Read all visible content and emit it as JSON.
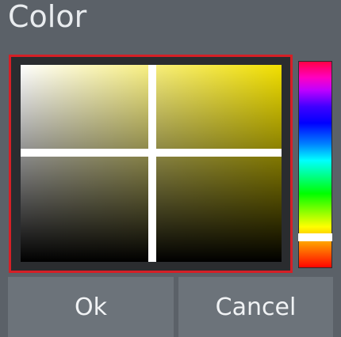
{
  "dialog": {
    "title": "Color"
  },
  "picker": {
    "selected_hue_color": "#f2e000",
    "frame_color": "#d51f26"
  },
  "buttons": {
    "ok_label": "Ok",
    "cancel_label": "Cancel"
  }
}
